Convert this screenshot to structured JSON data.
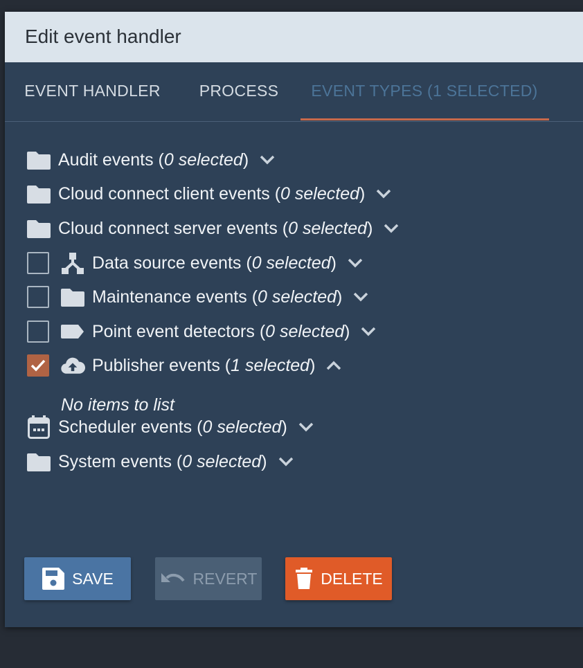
{
  "dialog": {
    "title": "Edit event handler"
  },
  "tabs": [
    {
      "label": "EVENT HANDLER",
      "active": false
    },
    {
      "label": "PROCESS",
      "active": false
    },
    {
      "label": "EVENT TYPES (1 SELECTED)",
      "active": true
    }
  ],
  "tree": {
    "items": [
      {
        "name": "Audit events",
        "count": "0 selected",
        "icon": "folder-icon",
        "checkbox": false,
        "expanded": false
      },
      {
        "name": "Cloud connect client events",
        "count": "0 selected",
        "icon": "folder-icon",
        "checkbox": false,
        "expanded": false
      },
      {
        "name": "Cloud connect server events",
        "count": "0 selected",
        "icon": "folder-icon",
        "checkbox": false,
        "expanded": false
      },
      {
        "name": "Data source events",
        "count": "0 selected",
        "icon": "data-source-icon",
        "checkbox": true,
        "checked": false,
        "expanded": false
      },
      {
        "name": "Maintenance events",
        "count": "0 selected",
        "icon": "folder-icon",
        "checkbox": true,
        "checked": false,
        "expanded": false
      },
      {
        "name": "Point event detectors",
        "count": "0 selected",
        "icon": "label-icon",
        "checkbox": true,
        "checked": false,
        "expanded": false
      },
      {
        "name": "Publisher events",
        "count": "1 selected",
        "icon": "cloud-upload-icon",
        "checkbox": true,
        "checked": true,
        "expanded": true
      },
      {
        "name": "Scheduler events",
        "count": "0 selected",
        "icon": "calendar-icon",
        "checkbox": false,
        "expanded": false
      },
      {
        "name": "System events",
        "count": "0 selected",
        "icon": "folder-icon",
        "checkbox": false,
        "expanded": false
      }
    ],
    "empty_text": "No items to list"
  },
  "buttons": {
    "save": "SAVE",
    "revert": "REVERT",
    "delete": "DELETE"
  },
  "colors": {
    "accent": "#c8694a",
    "save": "#4a74a3",
    "delete": "#e05b28",
    "panel": "#2e4157"
  }
}
